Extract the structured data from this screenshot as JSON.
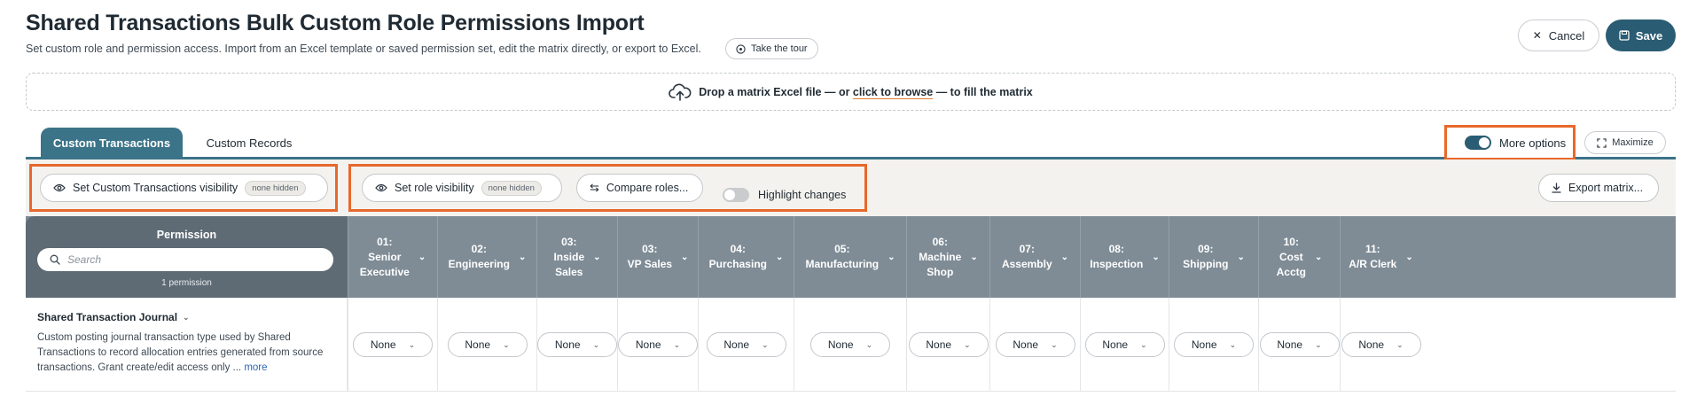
{
  "header": {
    "title": "Shared Transactions Bulk Custom Role Permissions Import",
    "subtitle": "Set custom role and permission access. Import from an Excel template or saved permission set, edit the matrix directly, or export to Excel.",
    "tour_label": "Take the tour",
    "cancel_label": "Cancel",
    "save_label": "Save"
  },
  "dropzone": {
    "prefix": "Drop a matrix Excel file — or ",
    "link": "click to browse",
    "suffix": " — to fill the matrix"
  },
  "tabs": [
    {
      "label": "Custom Transactions",
      "active": true
    },
    {
      "label": "Custom Records",
      "active": false
    }
  ],
  "options": {
    "more_options_label": "More options",
    "more_options_on": true,
    "maximize_label": "Maximize"
  },
  "toolbar": {
    "visibility_label": "Set Custom Transactions visibility",
    "visibility_badge": "none hidden",
    "role_visibility_label": "Set role visibility",
    "role_visibility_badge": "none hidden",
    "compare_label": "Compare roles...",
    "highlight_label": "Highlight changes",
    "highlight_on": false,
    "export_label": "Export matrix..."
  },
  "matrix": {
    "permission_header": "Permission",
    "search_placeholder": "Search",
    "permission_count": "1 permission",
    "roles": [
      "01: Senior Executive",
      "02: Engineering",
      "03: Inside Sales",
      "03: VP Sales",
      "04: Purchasing",
      "05: Manufacturing",
      "06: Machine Shop",
      "07: Assembly",
      "08: Inspection",
      "09: Shipping",
      "10: Cost Acctg",
      "11: A/R Clerk"
    ],
    "rows": [
      {
        "name": "Shared Transaction Journal",
        "description": "Custom posting journal transaction type used by Shared Transactions to record allocation entries generated from source transactions. Grant create/edit access only ...",
        "more_label": "more",
        "values": [
          "None",
          "None",
          "None",
          "None",
          "None",
          "None",
          "None",
          "None",
          "None",
          "None",
          "None",
          "None"
        ]
      }
    ]
  },
  "colors": {
    "accent": "#2a5d73",
    "tab_active": "#3b7388",
    "highlight_box": "#e8682b",
    "header_bg": "#7f8c96"
  }
}
